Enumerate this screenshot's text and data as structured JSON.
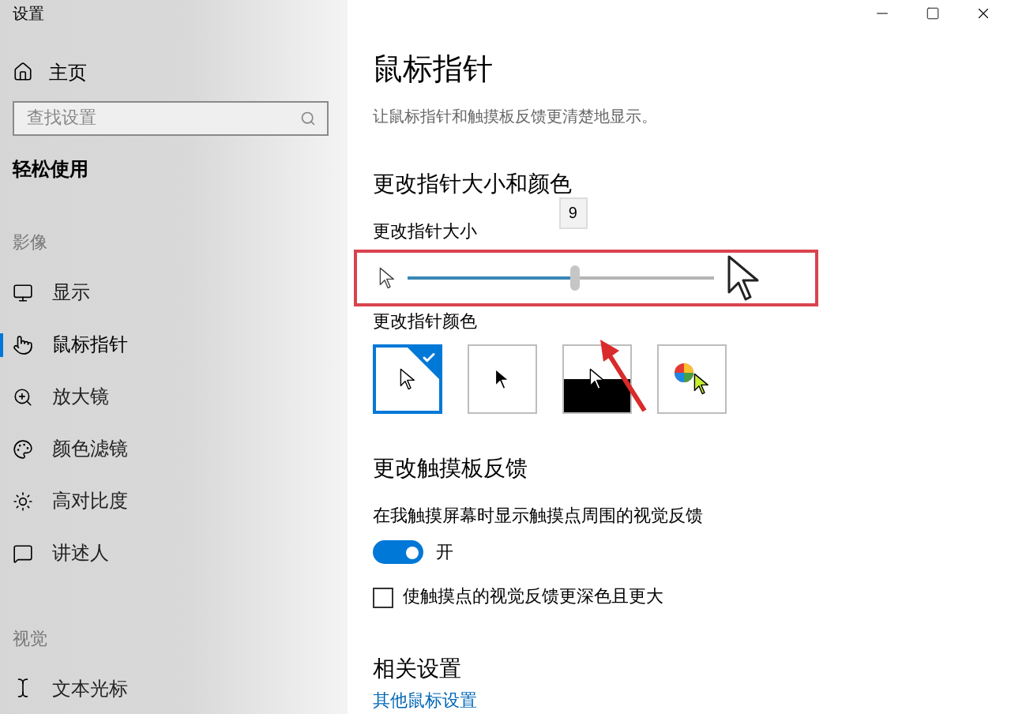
{
  "window": {
    "title": "设置"
  },
  "sidebar": {
    "home": "主页",
    "search": {
      "placeholder": "查找设置"
    },
    "category": "轻松使用",
    "groups": [
      {
        "heading": "影像",
        "items": [
          {
            "label": "显示",
            "kind": "display",
            "selected": false
          },
          {
            "label": "鼠标指针",
            "kind": "pointer",
            "selected": true
          },
          {
            "label": "放大镜",
            "kind": "magnifier",
            "selected": false
          },
          {
            "label": "颜色滤镜",
            "kind": "palette",
            "selected": false
          },
          {
            "label": "高对比度",
            "kind": "contrast",
            "selected": false
          },
          {
            "label": "讲述人",
            "kind": "narrator",
            "selected": false
          }
        ]
      },
      {
        "heading": "视觉",
        "items": [
          {
            "label": "文本光标",
            "kind": "textcursor",
            "selected": false
          }
        ]
      }
    ]
  },
  "page": {
    "title": "鼠标指针",
    "description": "让鼠标指针和触摸板反馈更清楚地显示。",
    "size_color": {
      "heading": "更改指针大小和颜色",
      "size_label": "更改指针大小",
      "size_slider": {
        "level": 0.55,
        "tooltip": "9"
      },
      "color_label": "更改指针颜色",
      "color_options": [
        {
          "kind": "white",
          "selected": true
        },
        {
          "kind": "black",
          "selected": false
        },
        {
          "kind": "inverted",
          "selected": false
        },
        {
          "kind": "custom",
          "selected": false
        }
      ]
    },
    "touch": {
      "heading": "更改触摸板反馈",
      "toggle_label": "在我触摸屏幕时显示触摸点周围的视觉反馈",
      "toggle": {
        "on": true,
        "text": "开"
      },
      "checkbox": {
        "label": "使触摸点的视觉反馈更深色且更大",
        "checked": false
      }
    },
    "related": {
      "heading": "相关设置",
      "link": "其他鼠标设置"
    }
  }
}
